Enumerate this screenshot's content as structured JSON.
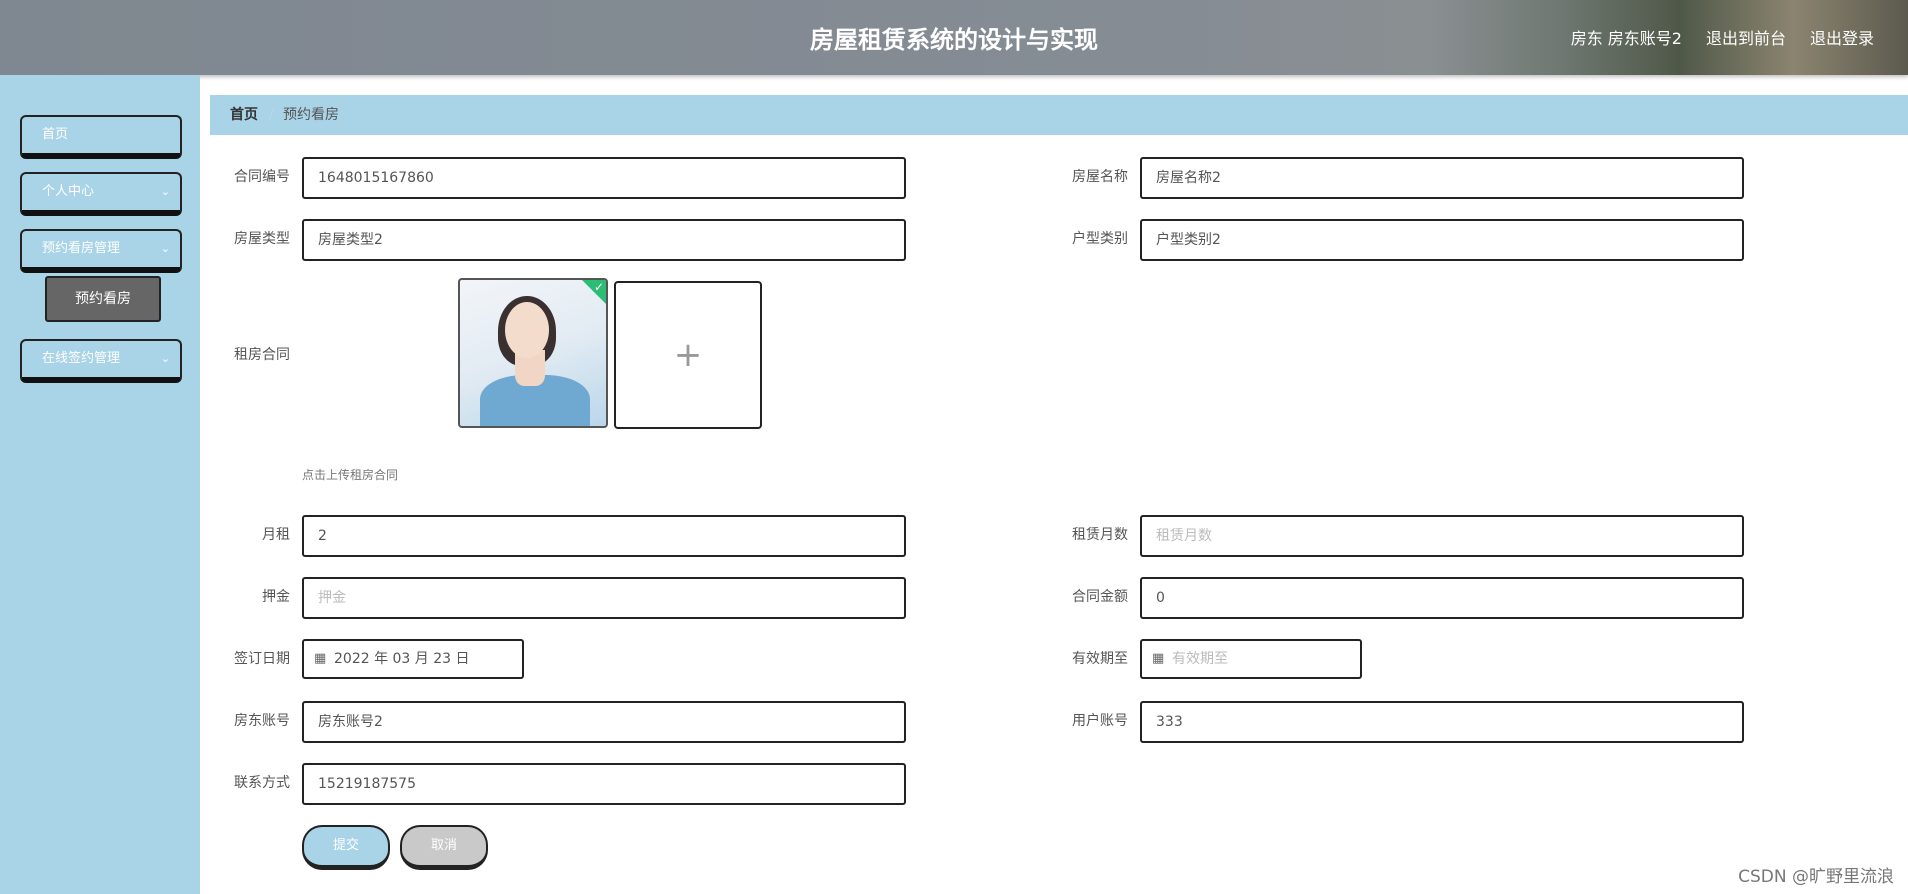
{
  "header": {
    "title": "房屋租赁系统的设计与实现",
    "user_label": "房东 房东账号2",
    "to_front_label": "退出到前台",
    "logout_label": "退出登录"
  },
  "sidebar": {
    "items": [
      {
        "label": "首页"
      },
      {
        "label": "个人中心",
        "chevron": "⌄"
      },
      {
        "label": "预约看房管理",
        "chevron": "⌄"
      },
      {
        "label": "在线签约管理",
        "chevron": "⌄"
      }
    ],
    "subitem": "预约看房"
  },
  "breadcrumb": {
    "home": "首页",
    "separator": "/",
    "current": "预约看房"
  },
  "form": {
    "contract_no": {
      "label": "合同编号",
      "value": "1648015167860"
    },
    "house_name": {
      "label": "房屋名称",
      "value": "房屋名称2"
    },
    "house_type": {
      "label": "房屋类型",
      "value": "房屋类型2"
    },
    "unit_type": {
      "label": "户型类别",
      "value": "户型类别2"
    },
    "rent_contract": {
      "label": "租房合同",
      "hint": "点击上传租房合同",
      "add_icon": "+"
    },
    "monthly_rent": {
      "label": "月租",
      "value": "2"
    },
    "lease_months": {
      "label": "租赁月数",
      "placeholder": "租赁月数"
    },
    "deposit": {
      "label": "押金",
      "placeholder": "押金"
    },
    "contract_amount": {
      "label": "合同金额",
      "value": "0"
    },
    "sign_date": {
      "label": "签订日期",
      "value": "2022 年 03 月 23 日"
    },
    "valid_until": {
      "label": "有效期至",
      "placeholder": "有效期至"
    },
    "landlord_account": {
      "label": "房东账号",
      "value": "房东账号2"
    },
    "user_account": {
      "label": "用户账号",
      "value": "333"
    },
    "contact": {
      "label": "联系方式",
      "value": "15219187575"
    }
  },
  "actions": {
    "submit": "提交",
    "cancel": "取消"
  },
  "watermark": "CSDN @旷野里流浪",
  "colors": {
    "accent": "#a9d3e6",
    "submenu": "#666666",
    "check": "#2dbc74"
  }
}
